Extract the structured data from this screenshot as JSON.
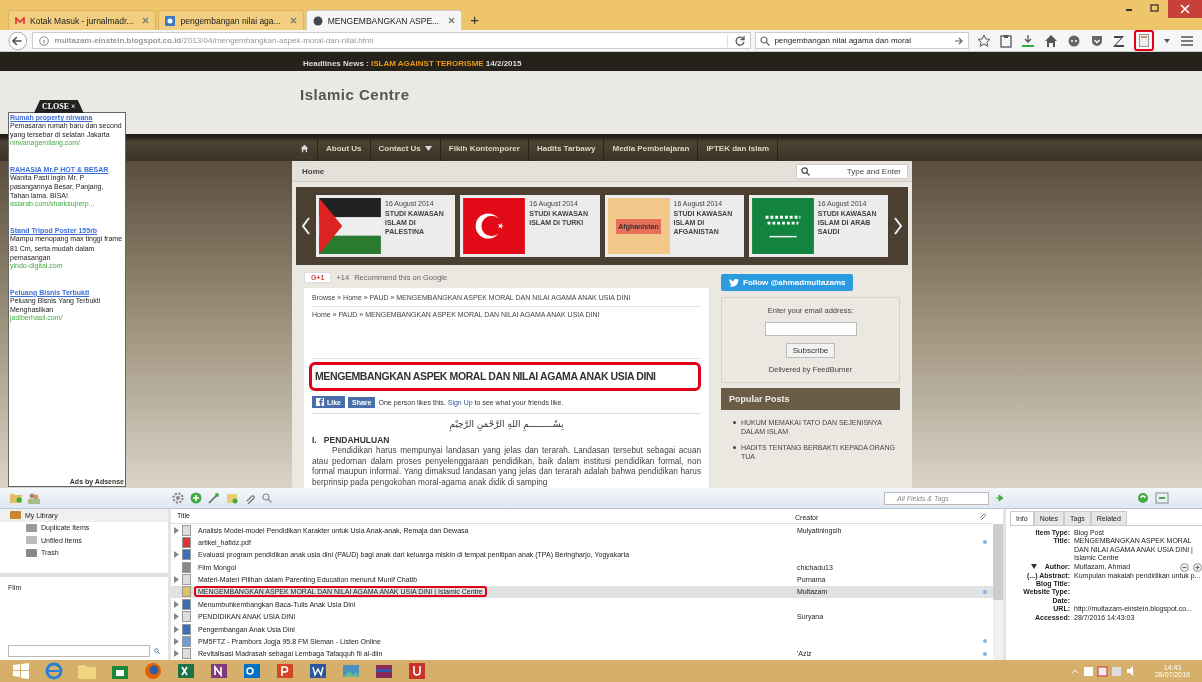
{
  "browser": {
    "tabs": [
      {
        "title": "Kotak Masuk - jurnalmadr...",
        "kind": "mail",
        "selected": false
      },
      {
        "title": "pengembangan nilai aga...",
        "kind": "search",
        "selected": false
      },
      {
        "title": "MENGEMBANGKAN ASPE...",
        "kind": "site",
        "selected": true
      }
    ],
    "new_tab": "+",
    "url": "**multazam-einstein.blogspot.co.id**/2013/04/mengembangkan-aspek-moral-dan-nilai.html",
    "search": "pengembangan nilai agama dan moral",
    "zotero_button_highlighted": true
  },
  "page": {
    "headline_label": "Headlines News :",
    "headline": "ISLAM AGAINST TERORISME",
    "headline_date": "14/2/2015",
    "site_title": "Islamic Centre",
    "nav": [
      {
        "label": "About Us",
        "dropdown": false
      },
      {
        "label": "Contact Us",
        "dropdown": true
      },
      {
        "label": "Fikih Kontemporer",
        "dropdown": false
      },
      {
        "label": "Hadits Tarbawy",
        "dropdown": false
      },
      {
        "label": "Media Pembelajaran",
        "dropdown": false
      },
      {
        "label": "IPTEK dan Islam",
        "dropdown": false
      }
    ],
    "home_label": "Home",
    "search_placeholder": "Type and Enter",
    "slider": [
      {
        "date": "16 August 2014",
        "title": "STUDI KAWASAN ISLAM DI PALESTINA",
        "kind": "palestine"
      },
      {
        "date": "16 August 2014",
        "title": "STUDI KAWASAN ISLAM DI TURKI",
        "kind": "turkey"
      },
      {
        "date": "16 August 2014",
        "title": "STUDI KAWASAN ISLAM DI AFGANISTAN",
        "kind": "afghanistan",
        "map_label": "Afghanistan"
      },
      {
        "date": "16 August 2014",
        "title": "STUDI KAWASAN ISLAM DI ARAB SAUDI",
        "kind": "saudi"
      }
    ],
    "gplus": {
      "button": "G+1",
      "count": "+14",
      "text": "Recommend this on Google"
    },
    "article": {
      "breadcrumb": "Browse » Home » PAUD » MENGEMBANGKAN ASPEK MORAL DAN NILAI AGAMA ANAK USIA DINI",
      "breadcrumb2": "Home » PAUD » MENGEMBANGKAN ASPEK MORAL DAN NILAI AGAMA ANAK USIA DINI",
      "title": "MENGEMBANGKAN ASPEK MORAL DAN NILAI AGAMA ANAK USIA DINI",
      "highlighted": true,
      "like": "Like",
      "share": "Share",
      "social_text": "One person likes this.",
      "signup": "Sign Up",
      "social_tail": "to see what your friends like.",
      "basmala": "بِسْـــــــــمِ اللهِ الرَّحْمَنِ الرَّحِيْمِ",
      "heading": "I.   PENDAHULUAN",
      "paragraph": "Pendidikan harus mempunyai landasan yang jelas dan terarah. Landasan tersebut sebagai acuan atau pedornan dalam proses penyelenggaraan pendidikan, baik dalam institusi pendidikan formal, non formal maupun informal. Yang dimaksud landasan yang jelas dan terarah adalah bahwa pendidikan harus berprinsip pada pengokohan moral-agama anak didik di samping"
    },
    "sidebar": {
      "follow": "Follow @ahmadmultazams",
      "email_label": "Enter your email address:",
      "subscribe": "Subscribe",
      "delivered": "Delivered by FeedBurner",
      "popular_title": "Popular Posts",
      "popular": [
        "HUKUM MEMAKAI TATO DAN SEJENISNYA DALAM ISLAM",
        "HADITS TENTANG BERBAKTI KEPADA ORANG TUA"
      ]
    },
    "ads": {
      "close": "CLOSE ×",
      "items": [
        {
          "title": "Rumah property nirwana",
          "text": "Pemasaran rumah baru dan second yang tersebar di selatan Jakarta",
          "url": "nirwanagemilang.com/"
        },
        {
          "title": "RAHASIA Mr.P HOT & BESAR",
          "text": "Wanita Pasti ingin Mr. P pasangannya Besar, Panjang, Tahan lama. BISA!",
          "url": "aslarab.com/sharksuperp..."
        },
        {
          "title": "Stand Tripod Poster 155rb",
          "text": "Mampu menopang max tinggi frame 81 Cm, serta mudah dalam pemasangan",
          "url": "yindo-digital.com"
        },
        {
          "title": "Peluang Bisnis Terbukti",
          "text": "Peluang Bisnis Yang Terbukti Menghasilkan",
          "url": "jadiberhasil.com/"
        }
      ],
      "footer": "Ads by Adsense"
    }
  },
  "zotero": {
    "search_placeholder": "All Fields & Tags",
    "collections": [
      {
        "label": "My Library",
        "kind": "library"
      },
      {
        "label": "Duplicate Items",
        "kind": "duplicate"
      },
      {
        "label": "Unfiled Items",
        "kind": "unfiled"
      },
      {
        "label": "Trash",
        "kind": "trash"
      }
    ],
    "tags": [
      "Film"
    ],
    "columns": [
      "Title",
      "Creator"
    ],
    "items": [
      {
        "title": "Analisis Model-model Pendidikan Karakter untuk Usia Anak-anak, Remaja dan Dewasa",
        "creator": "Mulyatiningsih",
        "kind": "document",
        "expandable": true,
        "attachment": false,
        "selected": false,
        "highlighted": false
      },
      {
        "title": "artikel_hafidz.pdf",
        "kind": "pdf",
        "expandable": false,
        "attachment": true,
        "selected": false,
        "highlighted": false
      },
      {
        "title": "Evaluasi program pendidikan anak usia dini (PAUD) bagi anak dari keluarga miskin di tempat penitipan anak (TPA) Beringharjo, Yogyakarta",
        "kind": "book",
        "expandable": true,
        "attachment": false,
        "selected": false,
        "highlighted": false
      },
      {
        "title": "Film Mongol",
        "creator": "chichadu13",
        "kind": "film",
        "expandable": false,
        "attachment": false,
        "selected": false,
        "highlighted": false
      },
      {
        "title": "Materi-Materi Pilihan dalam Parenting Education menurut Munif Chatib",
        "creator": "Purnama",
        "kind": "document",
        "expandable": true,
        "attachment": false,
        "selected": false,
        "highlighted": false
      },
      {
        "title": "MENGEMBANGKAN ASPEK MORAL DAN NILAI AGAMA ANAK USIA DINI | Islamic Centre",
        "creator": "Multazam",
        "kind": "blog",
        "expandable": false,
        "attachment": true,
        "selected": true,
        "highlighted": true
      },
      {
        "title": "Menumbuhkembangkan Baca-Tulis Anak Usia Dini",
        "kind": "book",
        "expandable": true,
        "attachment": false,
        "selected": false,
        "highlighted": false
      },
      {
        "title": "PENDIDIKAN ANAK USIA DINI",
        "creator": "Suryana",
        "kind": "document",
        "expandable": true,
        "attachment": false,
        "selected": false,
        "highlighted": false
      },
      {
        "title": "Pengembangan Anak Usia Dini",
        "kind": "book",
        "expandable": true,
        "attachment": false,
        "selected": false,
        "highlighted": false
      },
      {
        "title": "PM5FTZ - Prambors Jogja 95.8 FM Sleman - Listen Online",
        "kind": "webpage",
        "expandable": true,
        "attachment": true,
        "selected": false,
        "highlighted": false
      },
      {
        "title": "Revitalisasi Madrasah sebagai Lembaga Tafaqquh fii al-diin",
        "creator": "'Aziz",
        "kind": "document",
        "expandable": true,
        "attachment": true,
        "selected": false,
        "highlighted": false
      }
    ],
    "info_tabs": [
      {
        "label": "Info",
        "selected": true
      },
      {
        "label": "Notes",
        "selected": false
      },
      {
        "label": "Tags",
        "selected": false
      },
      {
        "label": "Related",
        "selected": false
      }
    ],
    "fields": [
      {
        "label": "Item Type:",
        "value": "Blog Post",
        "kind": "plain"
      },
      {
        "label": "Title:",
        "value": "MENGEMBANGKAN ASPEK MORAL DAN NILAI AGAMA ANAK USIA DINI | Islamic Centre",
        "kind": "plain"
      },
      {
        "label": "Author:",
        "value": "Multazam, Ahmad",
        "kind": "creator"
      },
      {
        "label": "(...) Abstract:",
        "value": "Kumpulan makalah pendidikan untuk p...",
        "kind": "plain"
      },
      {
        "label": "Blog Title:",
        "kind": "plain"
      },
      {
        "label": "Website Type:",
        "kind": "plain"
      },
      {
        "label": "Date:",
        "kind": "plain"
      },
      {
        "label": "URL:",
        "value": "http://multazam-einstein.blogspot.co...",
        "kind": "plain"
      },
      {
        "label": "Accessed:",
        "value": "28/7/2016 14:43:03",
        "kind": "plain"
      }
    ]
  },
  "clock": {
    "time": "14:43",
    "date": "28/07/2016"
  }
}
